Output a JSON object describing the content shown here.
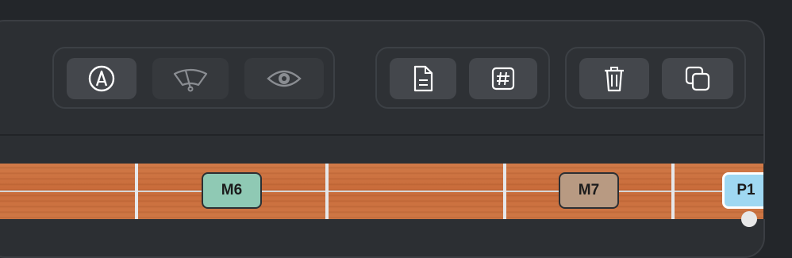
{
  "toolbar": {
    "group1": {
      "buttons": [
        {
          "icon": "pen-nib-icon",
          "state": "active"
        },
        {
          "icon": "wiper-icon",
          "state": "dim"
        },
        {
          "icon": "eye-icon",
          "state": "dim"
        }
      ]
    },
    "group2": {
      "buttons": [
        {
          "icon": "document-icon"
        },
        {
          "icon": "hash-icon"
        }
      ]
    },
    "group3": {
      "buttons": [
        {
          "icon": "trash-icon"
        },
        {
          "icon": "duplicate-icon"
        }
      ]
    }
  },
  "fretboard": {
    "notes": [
      {
        "label": "M6",
        "color": "#8fc9b4"
      },
      {
        "label": "M7",
        "color": "#b89a82"
      },
      {
        "label": "P1",
        "color": "#9fd8f2"
      }
    ]
  },
  "colors": {
    "background": "#23262a",
    "panel": "#2c2f33",
    "button": "#44474c",
    "icon_active": "#ffffff",
    "icon_dim": "#8a8d92",
    "wood": "#cd7443"
  }
}
